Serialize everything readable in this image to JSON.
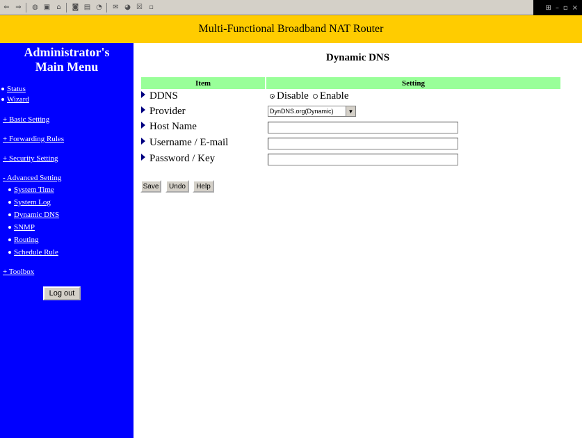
{
  "toolbar": {
    "icons": [
      "back-icon",
      "forward-icon",
      "stop-icon",
      "refresh-icon",
      "home-icon",
      "search-icon",
      "favorites-icon",
      "history-icon",
      "mail-icon",
      "print-icon",
      "edit-icon"
    ],
    "window_icons": [
      "windows-logo-icon",
      "minimize-icon",
      "maximize-icon",
      "close-icon"
    ]
  },
  "banner": {
    "title": "Multi-Functional Broadband NAT Router"
  },
  "sidebar": {
    "title_line1": "Administrator's",
    "title_line2": "Main Menu",
    "items": [
      {
        "label": "Status",
        "type": "bullet"
      },
      {
        "label": "Wizard",
        "type": "bullet"
      },
      {
        "label": "+ Basic Setting",
        "type": "group"
      },
      {
        "label": "+ Forwarding Rules",
        "type": "group"
      },
      {
        "label": "+ Security Setting",
        "type": "group"
      },
      {
        "label": "- Advanced Setting",
        "type": "group"
      },
      {
        "label": "System Time",
        "type": "sub"
      },
      {
        "label": "System Log",
        "type": "sub"
      },
      {
        "label": "Dynamic DNS",
        "type": "sub"
      },
      {
        "label": "SNMP",
        "type": "sub"
      },
      {
        "label": "Routing",
        "type": "sub"
      },
      {
        "label": "Schedule Rule",
        "type": "sub"
      },
      {
        "label": "+ Toolbox",
        "type": "group"
      }
    ],
    "logout_label": "Log out"
  },
  "main": {
    "title": "Dynamic DNS",
    "col_item": "Item",
    "col_setting": "Setting",
    "rows": {
      "ddns": "DDNS",
      "provider": "Provider",
      "host": "Host Name",
      "user": "Username / E-mail",
      "password": "Password / Key"
    },
    "ddns_options": {
      "disable": "Disable",
      "enable": "Enable",
      "selected": "Disable"
    },
    "provider_value": "DynDNS.org(Dynamic)",
    "host_value": "",
    "user_value": "",
    "password_value": "",
    "buttons": {
      "save": "Save",
      "undo": "Undo",
      "help": "Help"
    }
  }
}
